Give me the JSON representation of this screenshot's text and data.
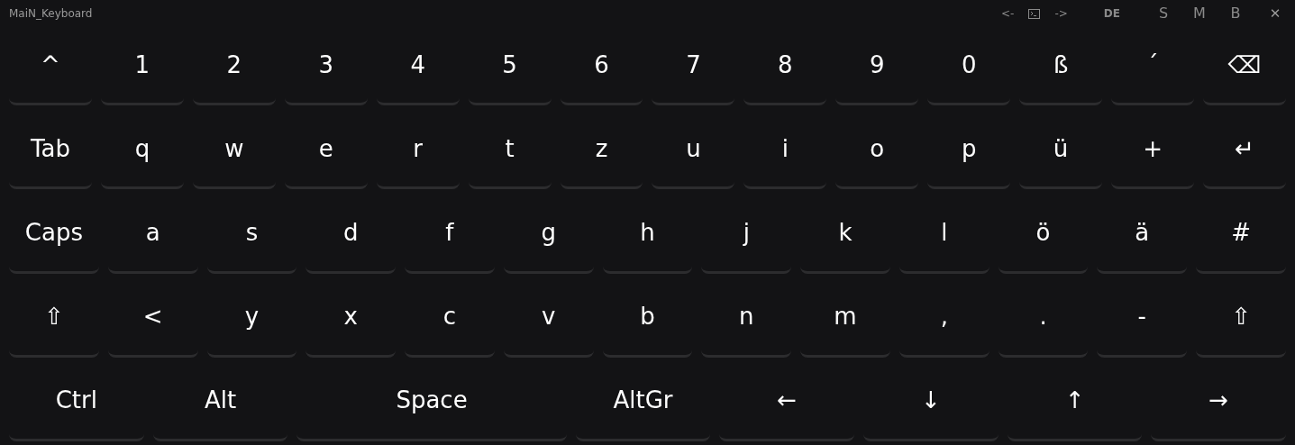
{
  "window": {
    "title": "MaiN_Keyboard"
  },
  "toolbar": [
    {
      "kind": "text",
      "label": "<-"
    },
    {
      "kind": "terminal"
    },
    {
      "kind": "text",
      "label": "->"
    },
    {
      "kind": "lang",
      "label": "DE"
    },
    {
      "kind": "text",
      "label": "S"
    },
    {
      "kind": "text",
      "label": "M"
    },
    {
      "kind": "text",
      "label": "B"
    },
    {
      "kind": "close",
      "label": "✕"
    }
  ],
  "rows": [
    [
      {
        "label": "^"
      },
      {
        "label": "1"
      },
      {
        "label": "2"
      },
      {
        "label": "3"
      },
      {
        "label": "4"
      },
      {
        "label": "5"
      },
      {
        "label": "6"
      },
      {
        "label": "7"
      },
      {
        "label": "8"
      },
      {
        "label": "9"
      },
      {
        "label": "0"
      },
      {
        "label": "ß"
      },
      {
        "label": "´"
      },
      {
        "label": "⌫"
      }
    ],
    [
      {
        "label": "Tab"
      },
      {
        "label": "q"
      },
      {
        "label": "w"
      },
      {
        "label": "e"
      },
      {
        "label": "r"
      },
      {
        "label": "t"
      },
      {
        "label": "z"
      },
      {
        "label": "u"
      },
      {
        "label": "i"
      },
      {
        "label": "o"
      },
      {
        "label": "p"
      },
      {
        "label": "ü"
      },
      {
        "label": "+"
      },
      {
        "label": "↵"
      }
    ],
    [
      {
        "label": "Caps"
      },
      {
        "label": "a"
      },
      {
        "label": "s"
      },
      {
        "label": "d"
      },
      {
        "label": "f"
      },
      {
        "label": "g"
      },
      {
        "label": "h"
      },
      {
        "label": "j"
      },
      {
        "label": "k"
      },
      {
        "label": "l"
      },
      {
        "label": "ö"
      },
      {
        "label": "ä"
      },
      {
        "label": "#"
      }
    ],
    [
      {
        "label": "⇧"
      },
      {
        "label": "<"
      },
      {
        "label": "y"
      },
      {
        "label": "x"
      },
      {
        "label": "c"
      },
      {
        "label": "v"
      },
      {
        "label": "b"
      },
      {
        "label": "n"
      },
      {
        "label": "m"
      },
      {
        "label": ","
      },
      {
        "label": "."
      },
      {
        "label": "-"
      },
      {
        "label": "⇧"
      }
    ],
    [
      {
        "label": "Ctrl"
      },
      {
        "label": "Alt"
      },
      {
        "kind": "space",
        "label": "Space"
      },
      {
        "label": "AltGr"
      },
      {
        "label": "←"
      },
      {
        "label": "↓"
      },
      {
        "label": "↑"
      },
      {
        "label": "→"
      }
    ]
  ]
}
